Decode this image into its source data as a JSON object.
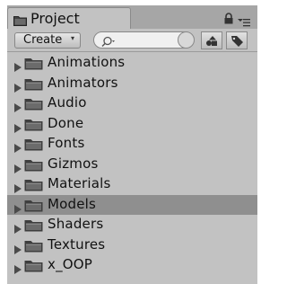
{
  "window": {
    "tab_title": "Project",
    "icons": {
      "tab": "folder-icon",
      "lock": "lock-icon",
      "menu": "panel-menu-icon"
    }
  },
  "toolbar": {
    "create_label": "Create",
    "create_caret": "▾",
    "search_placeholder": "",
    "search_value": ""
  },
  "tree": {
    "selected": "Models",
    "items": [
      {
        "label": "Animations"
      },
      {
        "label": "Animators"
      },
      {
        "label": "Audio"
      },
      {
        "label": "Done"
      },
      {
        "label": "Fonts"
      },
      {
        "label": "Gizmos"
      },
      {
        "label": "Materials"
      },
      {
        "label": "Models"
      },
      {
        "label": "Shaders"
      },
      {
        "label": "Textures"
      },
      {
        "label": "x_OOP"
      }
    ]
  },
  "colors": {
    "panel": "#c2c2c2",
    "tabstrip": "#a6a6a6",
    "selected_row": "#8f8f8f",
    "folder": "#4a4a4a"
  }
}
